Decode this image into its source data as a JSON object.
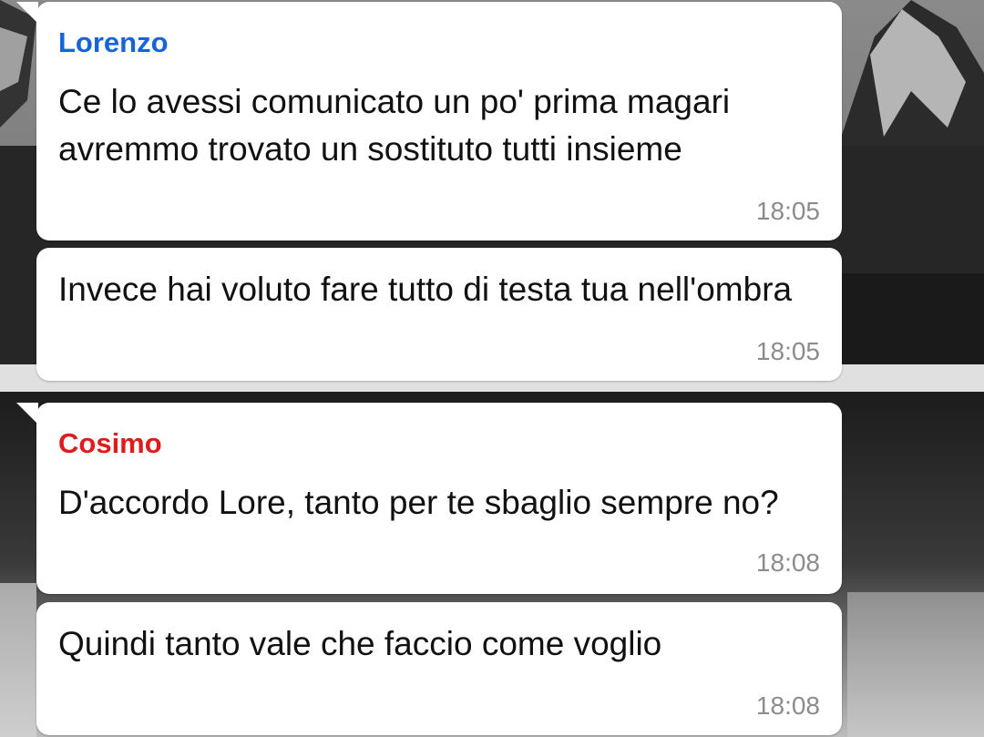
{
  "colors": {
    "bubble": "#ffffff",
    "lorenzo_name": "#1565d8",
    "cosimo_name": "#e01b1b",
    "message_text": "#111111",
    "timestamp": "#8c8c8c"
  },
  "messages": [
    {
      "sender": "Lorenzo",
      "text": "Ce lo avessi comunicato un po' prima magari avremmo trovato un sostituto tutti insieme",
      "time": "18:05"
    },
    {
      "text": "Invece hai voluto fare tutto di testa tua nell'ombra",
      "time": "18:05"
    },
    {
      "sender": "Cosimo",
      "text": "D'accordo Lore, tanto per te sbaglio sempre no?",
      "time": "18:08"
    },
    {
      "text": "Quindi tanto vale che faccio come voglio",
      "time": "18:08"
    }
  ]
}
